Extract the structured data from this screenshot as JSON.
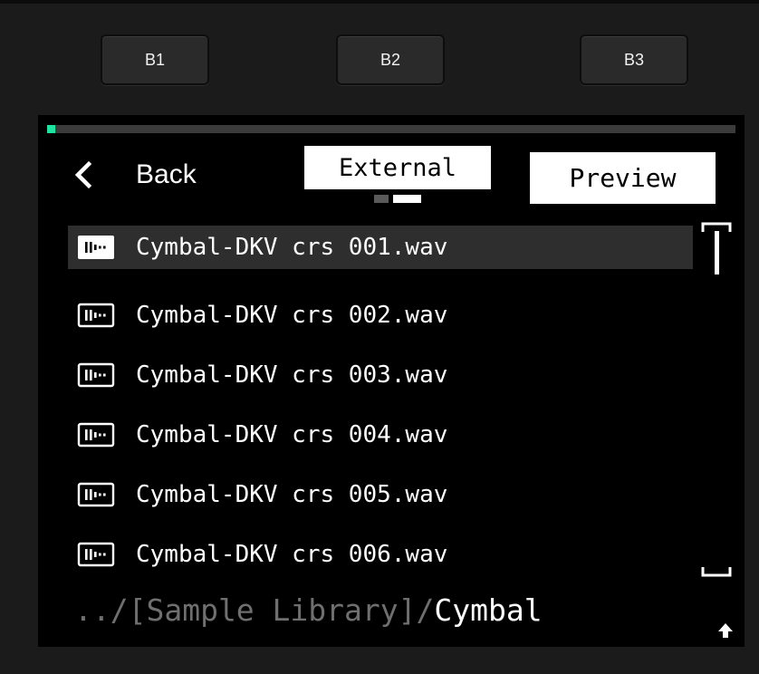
{
  "hardware_buttons": [
    {
      "label": "B1"
    },
    {
      "label": "B2"
    },
    {
      "label": "B3"
    }
  ],
  "progress": {
    "value": 0.012,
    "color": "#1fe3a0"
  },
  "nav": {
    "back_label": "Back",
    "back_icon": "chevron-left-icon",
    "source_tab": "External",
    "preview_label": "Preview",
    "page_indicator": {
      "pages": 2,
      "active": 2
    }
  },
  "files": [
    {
      "name": "Cymbal-DKV crs 001.wav",
      "selected": true
    },
    {
      "name": "Cymbal-DKV crs 002.wav",
      "selected": false
    },
    {
      "name": "Cymbal-DKV crs 003.wav",
      "selected": false
    },
    {
      "name": "Cymbal-DKV crs 004.wav",
      "selected": false
    },
    {
      "name": "Cymbal-DKV crs 005.wav",
      "selected": false
    },
    {
      "name": "Cymbal-DKV crs 006.wav",
      "selected": false
    }
  ],
  "file_icon": "audio-file-icon",
  "path": {
    "prefix": "../[Sample Library]/",
    "current": "Cymbal"
  },
  "up_icon": "arrow-up-icon"
}
